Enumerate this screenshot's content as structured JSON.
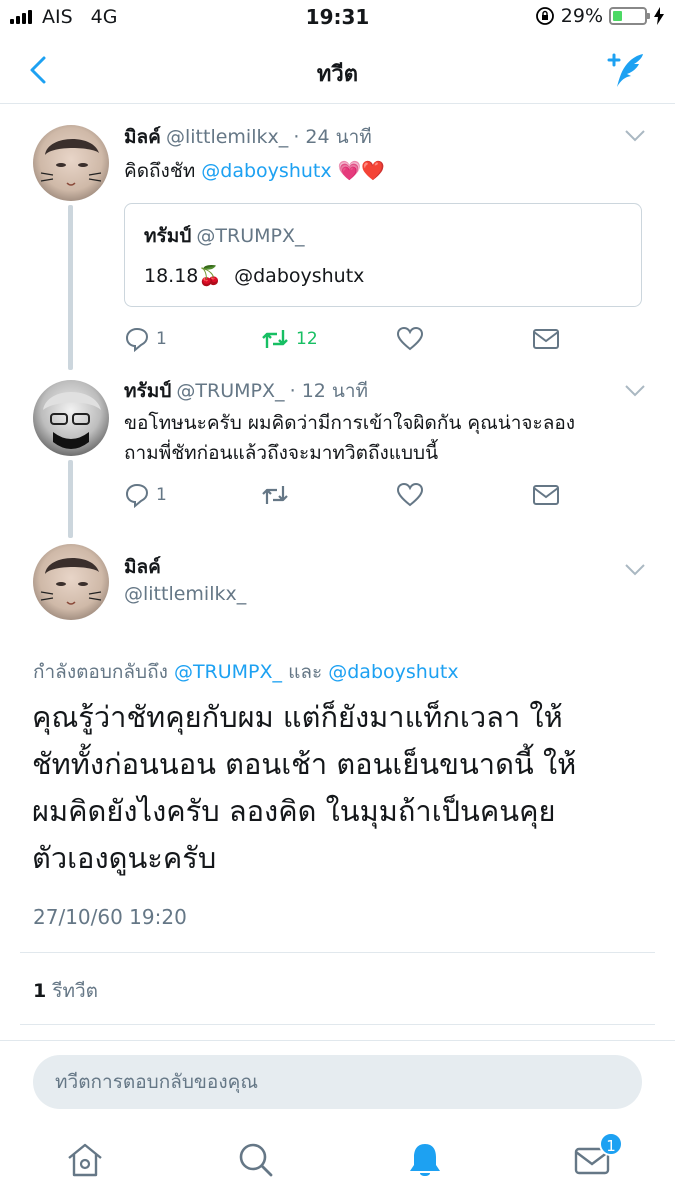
{
  "status_bar": {
    "carrier": "AIS",
    "network": "4G",
    "time": "19:31",
    "battery_percent": "29%",
    "battery_level": 0.29
  },
  "header": {
    "title": "ทวีต"
  },
  "tweets": [
    {
      "name": "มิลค์",
      "handle": "@littlemilkx_",
      "time": "· 24 นาที",
      "text_prefix": "คิดถึงชัท",
      "mention": "@daboyshutx",
      "emoji": "💗❤️",
      "quote": {
        "name": "ทรัมป์",
        "handle": "@TRUMPX_",
        "text": "18.18🍒",
        "mention": "@daboyshutx"
      },
      "replies": "1",
      "retweets": "12",
      "likes": ""
    },
    {
      "name": "ทรัมป์",
      "handle": "@TRUMPX_",
      "time": "· 12 นาที",
      "line1": "ขอโทษนะครับ ผมคิดว่ามีการเข้าใจผิดกัน คุณน่าจะลอง",
      "line2": "ถามพี่ชัทก่อนแล้วถึงจะมาทวิตถึงแบบนี้",
      "replies": "1",
      "retweets": "",
      "likes": ""
    }
  ],
  "main_tweet": {
    "name": "มิลค์",
    "handle": "@littlemilkx_",
    "replying_to_prefix": "กำลังตอบกลับถึง",
    "replying_to_user1": "@TRUMPX_",
    "replying_to_and": "และ",
    "replying_to_user2": "@daboyshutx",
    "text_lines": [
      "คุณรู้ว่าชัทคุยกับผม แต่ก็ยังมาแท็กเวลา ให้",
      "ชัททั้งก่อนนอน ตอนเช้า ตอนเย็นขนาดนี้ ให้",
      "ผมคิดยังไงครับ ลองคิด ในมุมถ้าเป็นคนคุย",
      "ตัวเองดูนะครับ"
    ],
    "timestamp": "27/10/60 19:20",
    "retweet_count": "1",
    "retweet_label": "รีทวีต"
  },
  "reply_bar": {
    "placeholder": "ทวีตการตอบกลับของคุณ"
  },
  "tabbar": {
    "items": [
      "home-icon",
      "search-icon",
      "notifications-icon",
      "messages-icon"
    ],
    "messages_badge": "1"
  },
  "colors": {
    "accent": "#1da1f2",
    "retweet_green": "#17bf63",
    "secondary_text": "#657786",
    "divider": "#e1e8ed"
  }
}
